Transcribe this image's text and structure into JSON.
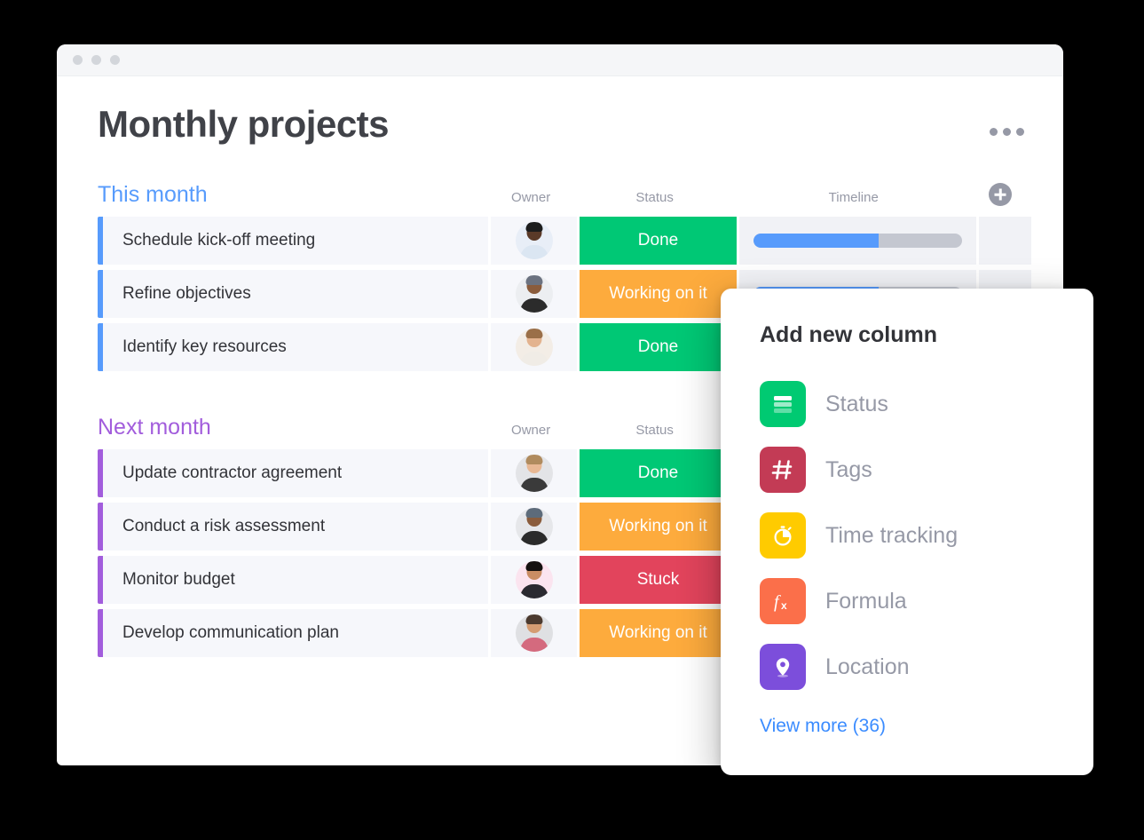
{
  "window": {
    "traffic_lights": [
      "dot-1",
      "dot-2",
      "dot-3"
    ]
  },
  "header": {
    "title": "Monthly projects",
    "menu_icon": "kebab-menu-icon"
  },
  "columns": {
    "owner": "Owner",
    "status": "Status",
    "timeline": "Timeline",
    "add_column_icon": "plus-circle-icon"
  },
  "groups": [
    {
      "title": "This month",
      "color": "#579bfc",
      "rows": [
        {
          "name": "Schedule kick-off meeting",
          "owner_avatar": "avatar-woman-glasses",
          "avatar_bg": "#e8eef7",
          "skin": "#5a3a28",
          "hair": "#1d1d1d",
          "shirt": "#dbe6f2",
          "status": "Done",
          "status_color": "#00c875",
          "timeline_progress": 60
        },
        {
          "name": "Refine objectives",
          "owner_avatar": "avatar-man-cap",
          "avatar_bg": "#eceef1",
          "skin": "#8a5c3c",
          "hair": "#6b7280",
          "shirt": "#2b2b2b",
          "status": "Working on it",
          "status_color": "#fdab3d",
          "timeline_progress": 60
        },
        {
          "name": "Identify key resources",
          "owner_avatar": "avatar-woman-blonde",
          "avatar_bg": "#f3ede6",
          "skin": "#e3b38f",
          "hair": "#9a6f48",
          "shirt": "#f0ece6",
          "status": "Done",
          "status_color": "#00c875",
          "timeline_progress": 60
        }
      ]
    },
    {
      "title": "Next month",
      "color": "#a25ddc",
      "rows": [
        {
          "name": "Update contractor agreement",
          "owner_avatar": "avatar-man-blond",
          "avatar_bg": "#e3e4e7",
          "skin": "#e8b894",
          "hair": "#b08b5e",
          "shirt": "#3a3a3a",
          "status": "Done",
          "status_color": "#00c875",
          "timeline_progress": 60
        },
        {
          "name": "Conduct a risk assessment",
          "owner_avatar": "avatar-man-cap",
          "avatar_bg": "#e6e7ea",
          "skin": "#8a5c3c",
          "hair": "#5d6b7a",
          "shirt": "#2b2b2b",
          "status": "Working on it",
          "status_color": "#fdab3d",
          "timeline_progress": 60
        },
        {
          "name": "Monitor budget",
          "owner_avatar": "avatar-woman-dark-hair",
          "avatar_bg": "#fbe4ef",
          "skin": "#c98d64",
          "hair": "#14110f",
          "shirt": "#2a2a30",
          "status": "Stuck",
          "status_color": "#e2445c",
          "timeline_progress": 60
        },
        {
          "name": "Develop communication plan",
          "owner_avatar": "avatar-man-beard",
          "avatar_bg": "#dfe0e3",
          "skin": "#d49c72",
          "hair": "#4b3a2f",
          "shirt": "#d46a7e",
          "status": "Working on it",
          "status_color": "#fdab3d",
          "timeline_progress": 60
        }
      ]
    }
  ],
  "popup": {
    "title": "Add new column",
    "items": [
      {
        "label": "Status",
        "icon": "status-bars-icon",
        "color": "#00ca72"
      },
      {
        "label": "Tags",
        "icon": "hash-tag-icon",
        "color": "#c33b55"
      },
      {
        "label": "Time tracking",
        "icon": "stopwatch-icon",
        "color": "#ffcb00"
      },
      {
        "label": "Formula",
        "icon": "formula-fx-icon",
        "color": "#fb6f4a"
      },
      {
        "label": "Location",
        "icon": "location-pin-icon",
        "color": "#7c4edb"
      }
    ],
    "view_more": "View more (36)"
  }
}
